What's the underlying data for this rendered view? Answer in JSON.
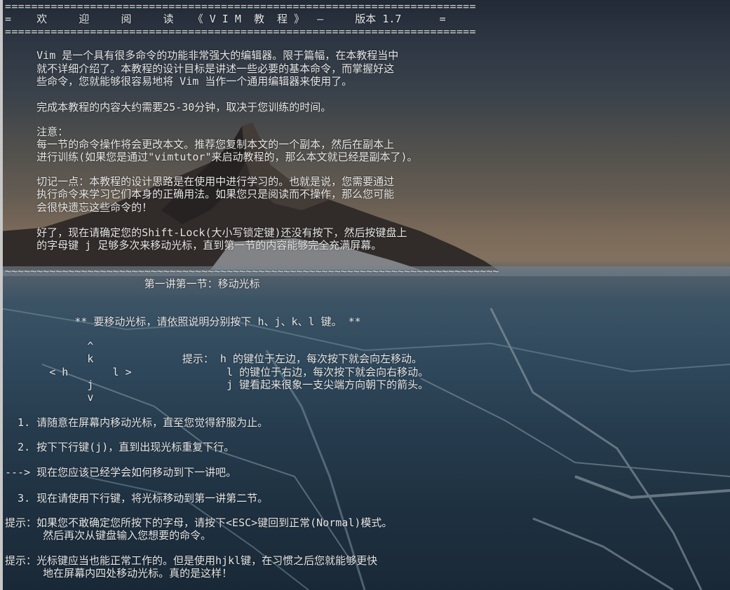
{
  "lines": {
    "rule_top": "========================================================================",
    "header": "=    欢     迎     阅     读   《 V I M  教  程 》  —     版本 1.7      =",
    "rule_bottom": "========================================================================",
    "intro_1": "     Vim 是一个具有很多命令的功能非常强大的编辑器。限于篇幅，在本教程当中",
    "intro_2": "     就不详细介绍了。本教程的设计目标是讲述一些必要的基本命令，而掌握好这",
    "intro_3": "     些命令，您就能够很容易地将 Vim 当作一个通用编辑器来使用了。",
    "time_1": "     完成本教程的内容大约需要25-30分钟，取决于您训练的时间。",
    "note_title": "     注意：",
    "note_1": "     每一节的命令操作将会更改本文。推荐您复制本文的一个副本，然后在副本上",
    "note_2": "     进行训练(如果您是通过\"vimtutor\"来启动教程的，那么本文就已经是副本了)。",
    "remember_1": "     切记一点：本教程的设计思路是在使用中进行学习的。也就是说，您需要通过",
    "remember_2": "     执行命令来学习它们本身的正确用法。如果您只是阅读而不操作，那么您可能",
    "remember_3": "     会很快遗忘这些命令的！",
    "ok_1": "     好了，现在请确定您的Shift-Lock(大小写锁定键)还没有按下，然后按键盘上",
    "ok_2": "     的字母键 j 足够多次来移动光标，直到第一节的内容能够完全充满屏幕。",
    "tilde": "~~~~~~~~~~~~~~~~~~~~~~~~~~~~~~~~~~~~~~~~~~~~~~~~~~~~~~~~~~~~~~~~~~~~~~~~~~~~~~",
    "lesson_title": "                      第一讲第一节：移动光标",
    "instruction": "           ** 要移动光标，请依照说明分别按下 h、j、k、l 键。 **",
    "arrow_1": "             ^",
    "arrow_2": "             k              提示： h 的键位于左边，每次按下就会向左移动。",
    "arrow_3": "       < h       l >               l 的键位于右边，每次按下就会向右移动。",
    "arrow_4": "             j                     j 键看起来很象一支尖端方向朝下的箭头。",
    "arrow_5": "             v",
    "step_1": "  1. 请随意在屏幕内移动光标，直至您觉得舒服为止。",
    "step_2": "  2. 按下下行键(j)，直到出现光标重复下行。",
    "step_arrow": "---> 现在您应该已经学会如何移动到下一讲吧。",
    "step_3": "  3. 现在请使用下行键，将光标移动到第一讲第二节。",
    "tip1_1": "提示：如果您不敢确定您所按下的字母，请按下<ESC>键回到正常(Normal)模式。",
    "tip1_2": "      然后再次从键盘输入您想要的命令。",
    "tip2_1": "提示：光标键应当也能正常工作的。但是使用hjkl键，在习惯之后您就能够更快",
    "tip2_2": "      地在屏幕内四处移动光标。真的是这样！"
  }
}
